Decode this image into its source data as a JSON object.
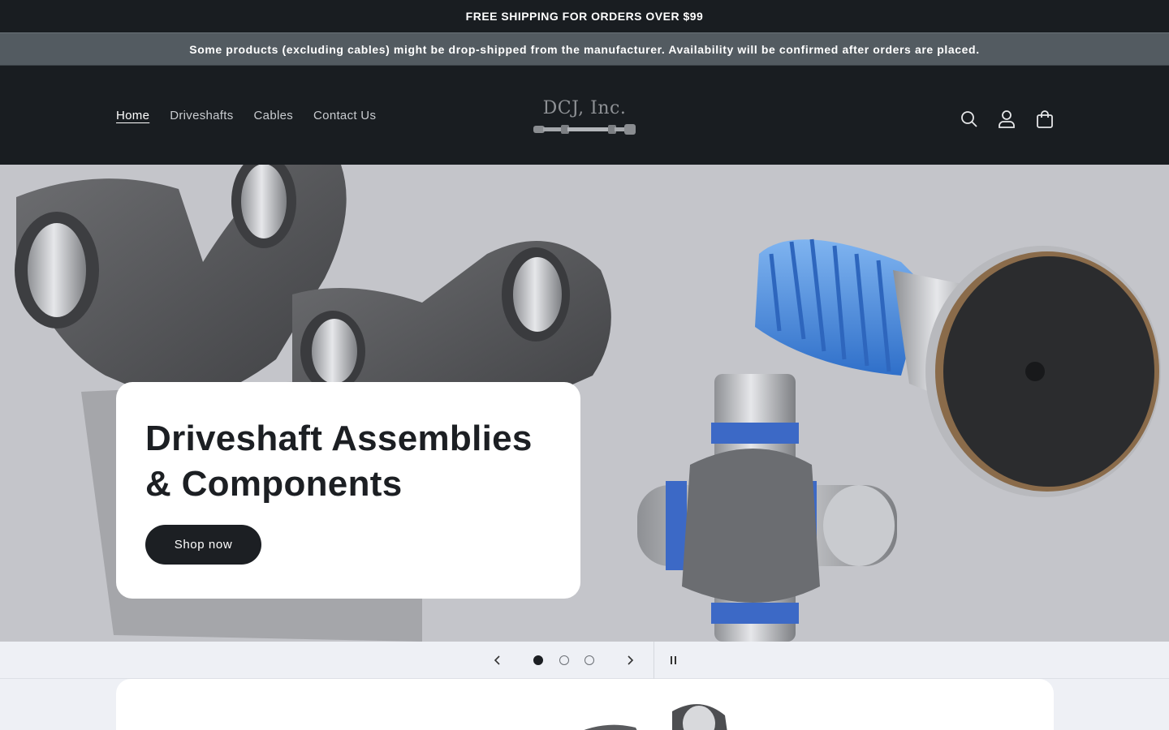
{
  "announcements": {
    "primary": "FREE SHIPPING FOR ORDERS OVER $99",
    "secondary": "Some products (excluding cables) might be drop-shipped from the manufacturer. Availability will be confirmed after orders are placed."
  },
  "header": {
    "nav": [
      {
        "label": "Home",
        "active": true
      },
      {
        "label": "Driveshafts",
        "active": false
      },
      {
        "label": "Cables",
        "active": false
      },
      {
        "label": "Contact Us",
        "active": false
      }
    ],
    "logo_text": "DCJ, Inc.",
    "icons": [
      "search-icon",
      "account-icon",
      "cart-icon"
    ]
  },
  "hero": {
    "title": "Driveshaft Assemblies & Components",
    "cta": "Shop now"
  },
  "slideshow": {
    "slide_count": 3,
    "active_slide": 1,
    "icons": [
      "chevron-left-icon",
      "chevron-right-icon",
      "pause-icon"
    ]
  },
  "colors": {
    "header_bg": "#191d21",
    "announcement_bg": "#535b61",
    "hero_bg": "#c4c5ca",
    "accent_blue": "#3f7ed8"
  }
}
